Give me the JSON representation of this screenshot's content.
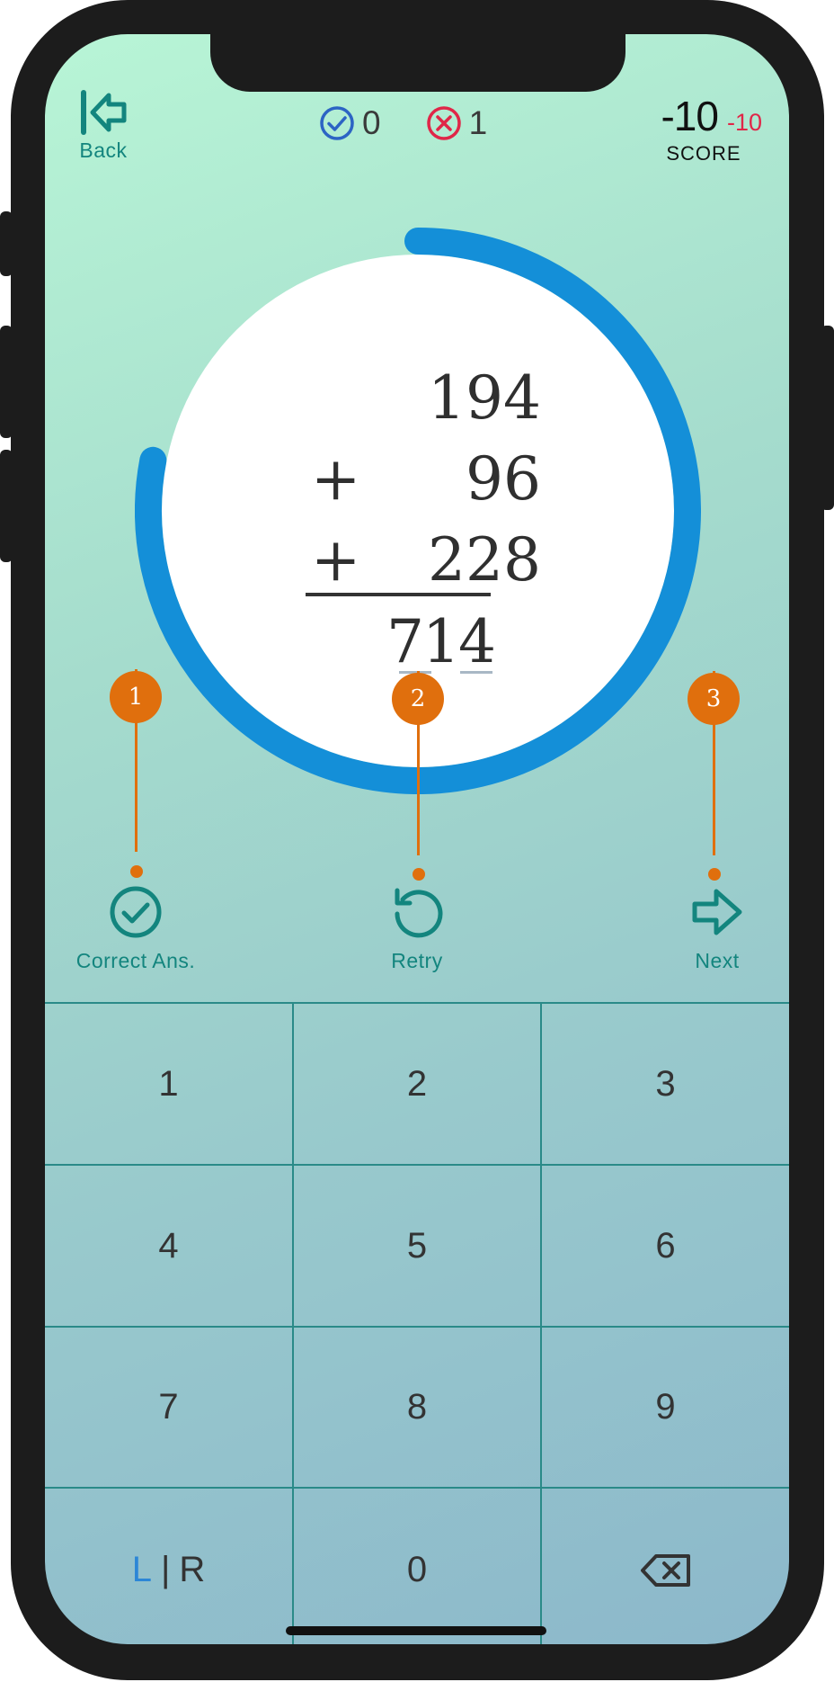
{
  "header": {
    "back_label": "Back",
    "correct_count": "0",
    "wrong_count": "1",
    "score_value": "-10",
    "score_delta": "-10",
    "score_label": "SCORE"
  },
  "timer": {
    "remaining_fraction": 0.78
  },
  "problem": {
    "operands": [
      "194",
      "96",
      "228"
    ],
    "operators": [
      "+",
      "+"
    ],
    "answer_digits": [
      "7",
      "1",
      "4"
    ]
  },
  "callouts": [
    "1",
    "2",
    "3"
  ],
  "actions": {
    "correct_label": "Correct Ans.",
    "retry_label": "Retry",
    "next_label": "Next"
  },
  "keypad": {
    "keys": [
      "1",
      "2",
      "3",
      "4",
      "5",
      "6",
      "7",
      "8",
      "9"
    ],
    "lr_left": "L",
    "lr_sep": "|",
    "lr_right": "R",
    "zero": "0"
  },
  "colors": {
    "accent": "#13857e",
    "timer": "#148fd8",
    "callout": "#e06f0d",
    "negative": "#e02648",
    "correct_icon": "#2c64c4",
    "wrong_icon": "#e02648"
  }
}
